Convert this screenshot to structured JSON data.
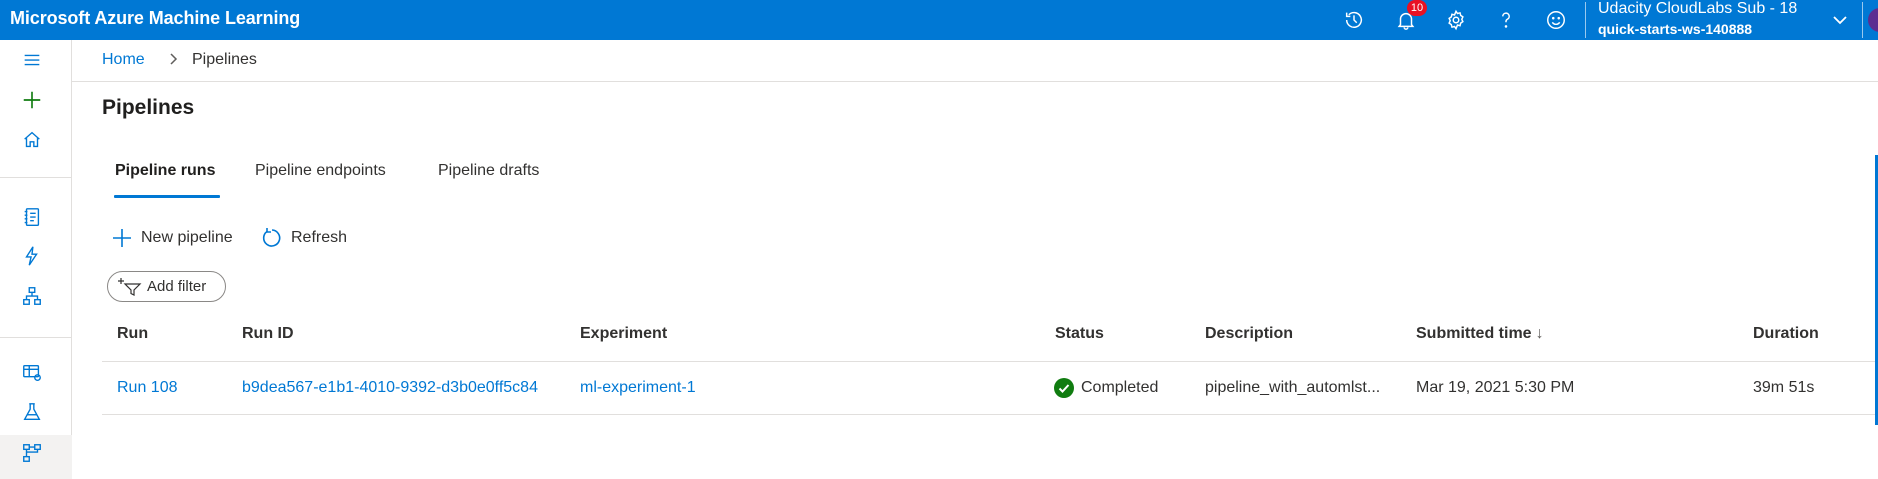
{
  "app": {
    "title": "Microsoft Azure Machine Learning"
  },
  "topbar": {
    "notifications_count": "10",
    "account": {
      "subscription": "Udacity CloudLabs Sub - 18",
      "workspace": "quick-starts-ws-140888"
    },
    "icons": [
      "history-icon",
      "bell-icon",
      "gear-icon",
      "help-icon",
      "feedback-smiley-icon",
      "chevron-down-icon"
    ]
  },
  "leftnav": {
    "icons": [
      "hamburger-icon",
      "plus-icon",
      "home-icon",
      "notebook-icon",
      "automl-icon",
      "designer-icon",
      "datasets-icon",
      "experiments-icon",
      "pipelines-icon"
    ]
  },
  "breadcrumb": {
    "home": "Home",
    "current": "Pipelines"
  },
  "page": {
    "title": "Pipelines"
  },
  "tabs": [
    {
      "label": "Pipeline runs",
      "active": true
    },
    {
      "label": "Pipeline endpoints",
      "active": false
    },
    {
      "label": "Pipeline drafts",
      "active": false
    }
  ],
  "commands": {
    "new_pipeline": "New pipeline",
    "refresh": "Refresh"
  },
  "filter": {
    "label": "Add filter"
  },
  "table": {
    "headers": {
      "run": "Run",
      "run_id": "Run ID",
      "experiment": "Experiment",
      "status": "Status",
      "description": "Description",
      "submitted_time": "Submitted time",
      "submitted_sort": "↓",
      "duration": "Duration"
    },
    "rows": [
      {
        "run": "Run 108",
        "run_id": "b9dea567-e1b1-4010-9392-d3b0e0ff5c84",
        "experiment": "ml-experiment-1",
        "status": "Completed",
        "description": "pipeline_with_automlst...",
        "submitted_time": "Mar 19, 2021 5:30 PM",
        "duration": "39m 51s"
      }
    ]
  },
  "colors": {
    "accent": "#0078d4",
    "success": "#107c10",
    "badge": "#e81123"
  }
}
